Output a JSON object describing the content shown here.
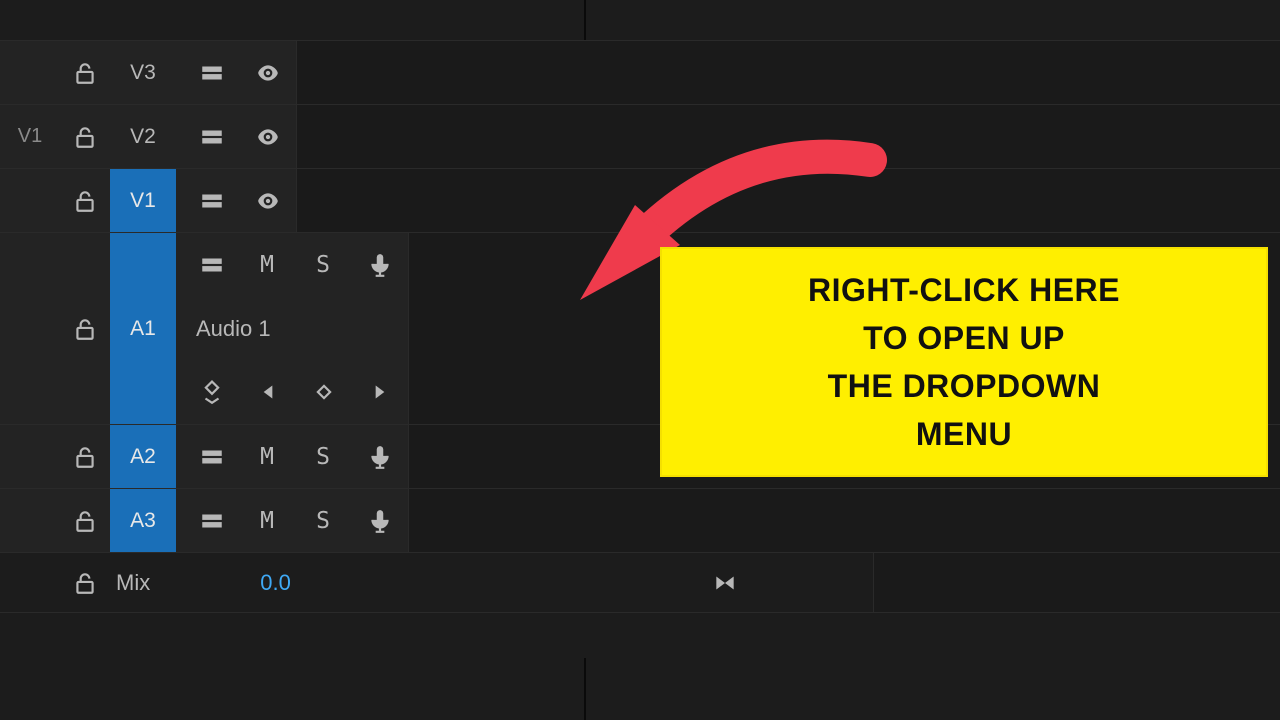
{
  "tracks": {
    "sourcePatch": "V1",
    "video": [
      {
        "label": "V3",
        "targeted": false
      },
      {
        "label": "V2",
        "targeted": false
      },
      {
        "label": "V1",
        "targeted": true
      }
    ],
    "audio": [
      {
        "label": "A1",
        "name": "Audio 1",
        "targeted": true,
        "expanded": true,
        "mute": "M",
        "solo": "S"
      },
      {
        "label": "A2",
        "targeted": true,
        "expanded": false,
        "mute": "M",
        "solo": "S"
      },
      {
        "label": "A3",
        "targeted": true,
        "expanded": false,
        "mute": "M",
        "solo": "S"
      }
    ]
  },
  "mix": {
    "label": "Mix",
    "value": "0.0"
  },
  "callout": {
    "line1": "RIGHT-CLICK HERE",
    "line2": "TO OPEN UP",
    "line3": "THE DROPDOWN",
    "line4": "MENU"
  },
  "colors": {
    "target_blue": "#1a6fb8",
    "link_blue": "#3fa9f5",
    "callout_yellow": "#ffef00",
    "arrow_red": "#ef3b4c"
  }
}
